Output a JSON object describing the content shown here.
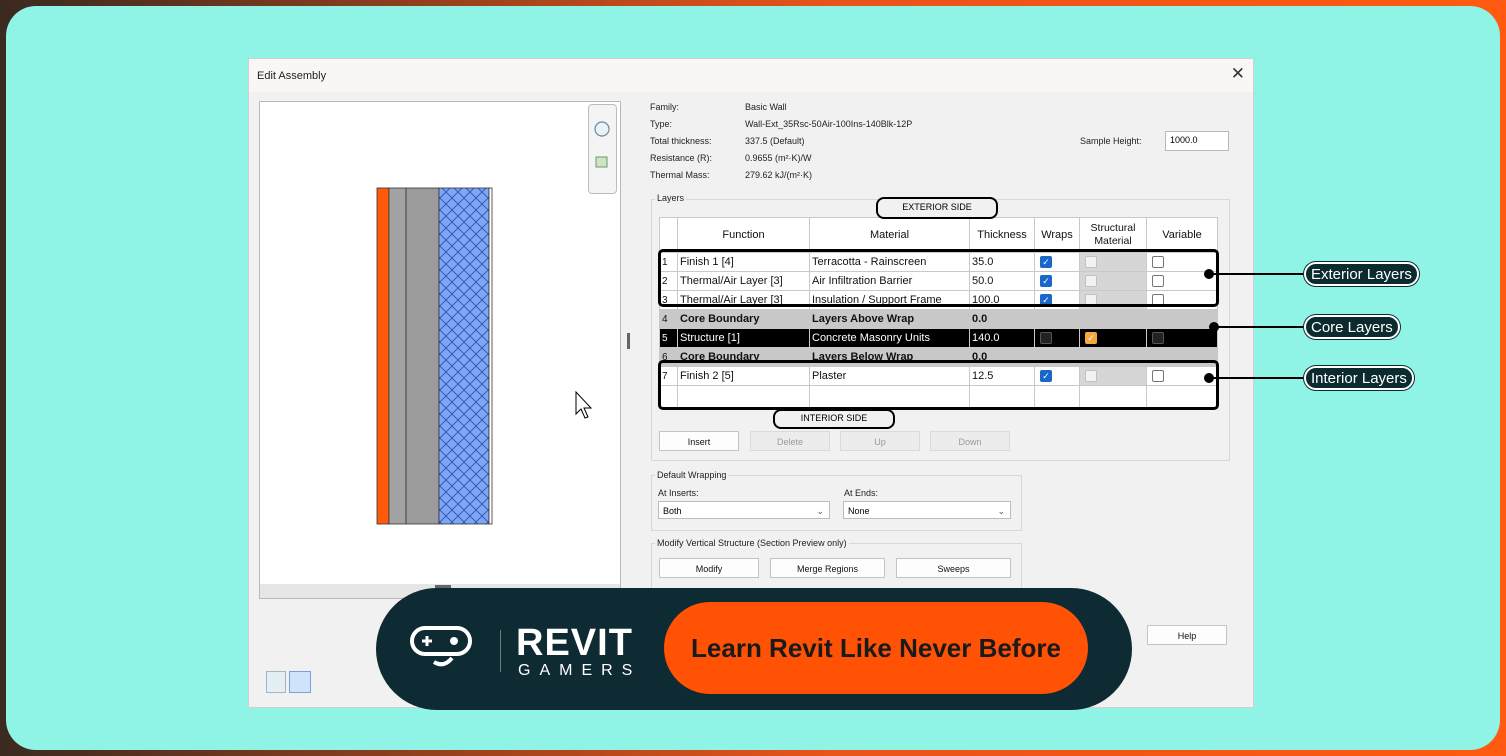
{
  "dialog": {
    "title": "Edit Assembly",
    "close_glyph": "✕"
  },
  "info": {
    "family_label": "Family:",
    "family_value": "Basic Wall",
    "type_label": "Type:",
    "type_value": "Wall-Ext_35Rsc-50Air-100Ins-140Blk-12P",
    "thickness_label": "Total thickness:",
    "thickness_value": "337.5 (Default)",
    "resistance_label": "Resistance (R):",
    "resistance_value": "0.9655 (m²·K)/W",
    "mass_label": "Thermal Mass:",
    "mass_value": "279.62 kJ/(m²·K)",
    "sample_height_label": "Sample Height:",
    "sample_height_value": "1000.0"
  },
  "layers": {
    "group_label": "Layers",
    "exterior_side": "EXTERIOR SIDE",
    "interior_side": "INTERIOR SIDE",
    "columns": [
      "Function",
      "Material",
      "Thickness",
      "Wraps",
      "Structural Material",
      "Variable"
    ],
    "rows": [
      {
        "num": "1",
        "function": "Finish 1 [4]",
        "material": "Terracotta - Rainscreen",
        "thickness": "35.0"
      },
      {
        "num": "2",
        "function": "Thermal/Air Layer [3]",
        "material": "Air Infiltration Barrier",
        "thickness": "50.0"
      },
      {
        "num": "3",
        "function": "Thermal/Air Layer [3]",
        "material": "Insulation / Support Frame",
        "thickness": "100.0"
      },
      {
        "num": "4",
        "function": "Core Boundary",
        "material": "Layers Above Wrap",
        "thickness": "0.0"
      },
      {
        "num": "5",
        "function": "Structure [1]",
        "material": "Concrete Masonry Units",
        "thickness": "140.0"
      },
      {
        "num": "6",
        "function": "Core Boundary",
        "material": "Layers Below Wrap",
        "thickness": "0.0"
      },
      {
        "num": "7",
        "function": "Finish 2 [5]",
        "material": "Plaster",
        "thickness": "12.5"
      }
    ],
    "buttons": {
      "insert": "Insert",
      "delete": "Delete",
      "up": "Up",
      "down": "Down"
    }
  },
  "wrapping": {
    "group_label": "Default Wrapping",
    "inserts_label": "At Inserts:",
    "inserts_value": "Both",
    "ends_label": "At Ends:",
    "ends_value": "None"
  },
  "vertical": {
    "group_label": "Modify Vertical Structure (Section Preview only)",
    "modify": "Modify",
    "merge": "Merge Regions",
    "sweeps": "Sweeps"
  },
  "help_button": "Help",
  "callouts": {
    "exterior": "Exterior Layers",
    "core": "Core Layers",
    "interior": "Interior Layers"
  },
  "banner": {
    "brand_main": "REVIT",
    "brand_sub": "GAMERS",
    "cta": "Learn Revit Like Never Before"
  },
  "colors": {
    "background": "#8ff4e6",
    "brand_orange": "#ff5205",
    "banner_navy": "#0e2a33",
    "finish_layer": "#ff5a0a",
    "insulation_layer": "#7fa6f2"
  }
}
